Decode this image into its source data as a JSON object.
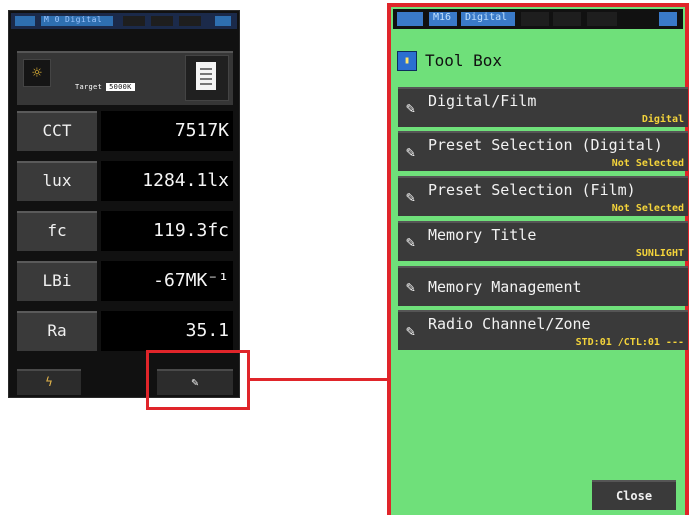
{
  "left_screen": {
    "status": {
      "channel": "M 0",
      "mode": "Digital"
    },
    "target": {
      "label": "Target",
      "value": "5000K"
    },
    "rows": [
      {
        "label": "CCT",
        "value": "7517K"
      },
      {
        "label": "lux",
        "value": "1284.1lx"
      },
      {
        "label": "fc",
        "value": "119.3fc"
      },
      {
        "label": "LBi",
        "value": "-67MK⁻¹"
      },
      {
        "label": "Ra",
        "value": "35.1"
      }
    ]
  },
  "right_screen": {
    "status": {
      "channel": "M16",
      "mode": "Digital"
    },
    "title": "Tool Box",
    "menu": [
      {
        "label": "Digital/Film",
        "value": "Digital"
      },
      {
        "label": "Preset Selection (Digital)",
        "value": "Not Selected"
      },
      {
        "label": "Preset Selection (Film)",
        "value": "Not Selected"
      },
      {
        "label": "Memory Title",
        "value": "SUNLIGHT"
      },
      {
        "label": "Memory Management",
        "value": ""
      },
      {
        "label": "Radio Channel/Zone",
        "value": "STD:01 /CTL:01 ---"
      }
    ],
    "close_label": "Close"
  },
  "colors": {
    "highlight": "#e0252a",
    "screen_bg": "#6fe07a",
    "value_yellow": "#f4d43a"
  }
}
